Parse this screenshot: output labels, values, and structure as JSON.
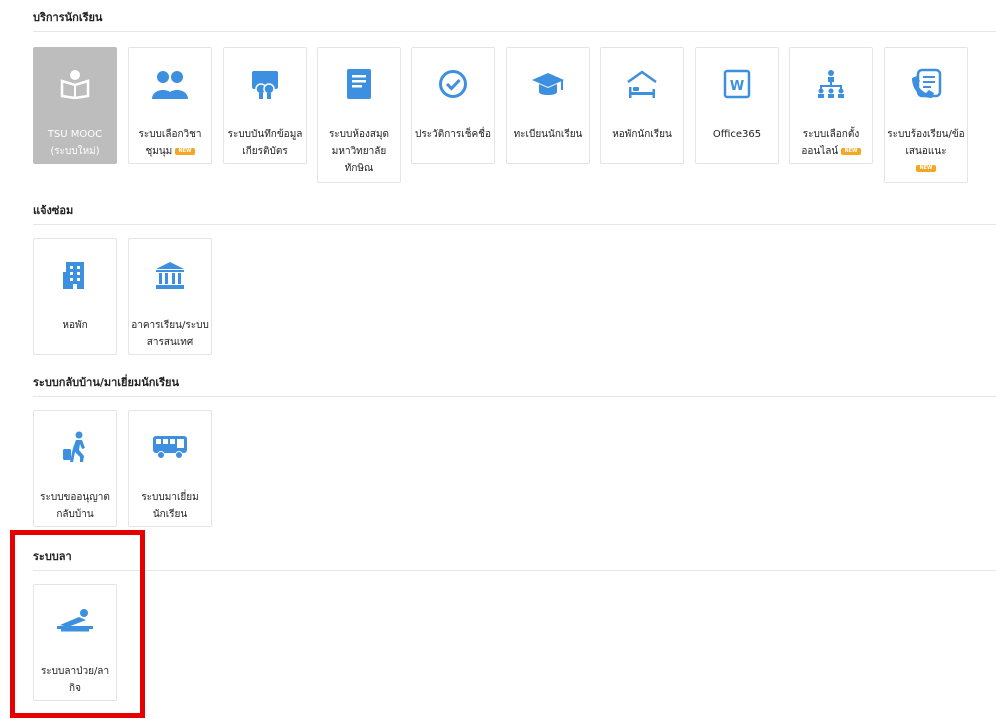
{
  "sections": {
    "student_services": {
      "title": "บริการนักเรียน",
      "tiles": [
        {
          "label": "TSU MOOC (ระบบใหม่)",
          "icon": "open-book-reader-icon"
        },
        {
          "label": "ระบบเลือกวิชาชุมนุม",
          "icon": "students-group-icon",
          "badge": "NEW"
        },
        {
          "label": "ระบบบันทึกข้อมูลเกียรติบัตร",
          "icon": "certificate-board-icon"
        },
        {
          "label": "ระบบห้องสมุดมหาวิทยาลัยทักษิณ",
          "icon": "book-icon"
        },
        {
          "label": "ประวัติการเช็คชื่อ",
          "icon": "check-circle-icon"
        },
        {
          "label": "ทะเบียนนักเรียน",
          "icon": "graduation-cap-icon"
        },
        {
          "label": "หอพักนักเรียน",
          "icon": "dorm-bed-icon"
        },
        {
          "label": "Office365",
          "icon": "word-document-icon"
        },
        {
          "label": "ระบบเลือกตั้งออนไลน์",
          "icon": "org-chart-icon",
          "badge": "NEW"
        },
        {
          "label": "ระบบร้องเรียน/ข้อเสนอแนะ",
          "icon": "phone-list-icon",
          "badge": "NEW"
        }
      ]
    },
    "repair": {
      "title": "แจ้งซ่อม",
      "tiles": [
        {
          "label": "หอพัก",
          "icon": "building-icon"
        },
        {
          "label": "อาคารเรียน/ระบบสารสนเทศ",
          "icon": "institution-icon"
        }
      ]
    },
    "home_visit": {
      "title": "ระบบกลับบ้าน/มาเยี่ยมนักเรียน",
      "tiles": [
        {
          "label": "ระบบขออนุญาตกลับบ้าน",
          "icon": "traveler-walking-icon"
        },
        {
          "label": "ระบบมาเยี่ยมนักเรียน",
          "icon": "bus-icon"
        }
      ]
    },
    "leave": {
      "title": "ระบบลา",
      "tiles": [
        {
          "label": "ระบบลาป่วย/ลากิจ",
          "icon": "patient-bed-icon"
        }
      ]
    }
  },
  "colors": {
    "icon_blue": "#3d8fe0",
    "active_tile": "#bdbdbd",
    "badge": "#f5a623",
    "highlight": "#e60000"
  }
}
